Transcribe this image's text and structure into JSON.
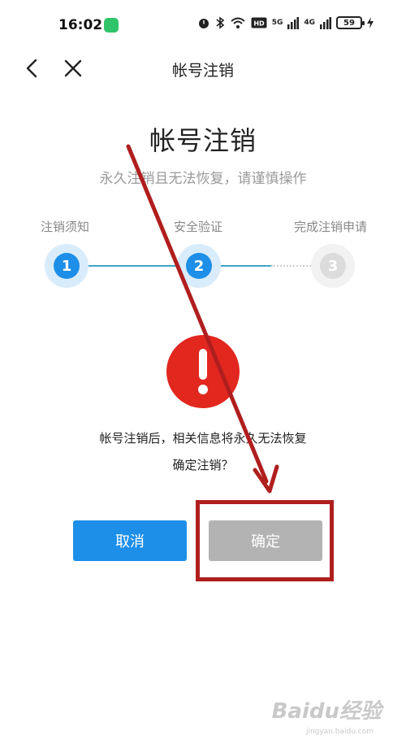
{
  "status_bar": {
    "time": "16:02",
    "battery": "59",
    "network_a": "5G",
    "network_b": "4G"
  },
  "nav": {
    "title": "帐号注销"
  },
  "header": {
    "title": "帐号注销",
    "subtitle": "永久注销且无法恢复，请谨慎操作"
  },
  "steps": [
    {
      "label": "注销须知",
      "number": "1",
      "state": "done"
    },
    {
      "label": "安全验证",
      "number": "2",
      "state": "current"
    },
    {
      "label": "完成注销申请",
      "number": "3",
      "state": "pending"
    }
  ],
  "warning": {
    "text": "帐号注销后，相关信息将永久无法恢复",
    "question": "确定注销？"
  },
  "buttons": {
    "cancel": "取消",
    "confirm": "确定"
  },
  "watermark": {
    "logo": "Baidu经验",
    "url": "jingyan.baidu.com"
  },
  "colors": {
    "accent": "#1d8fe8",
    "warning": "#e2271f",
    "annotation": "#b01e1e",
    "disabled": "#b3b3b3"
  }
}
